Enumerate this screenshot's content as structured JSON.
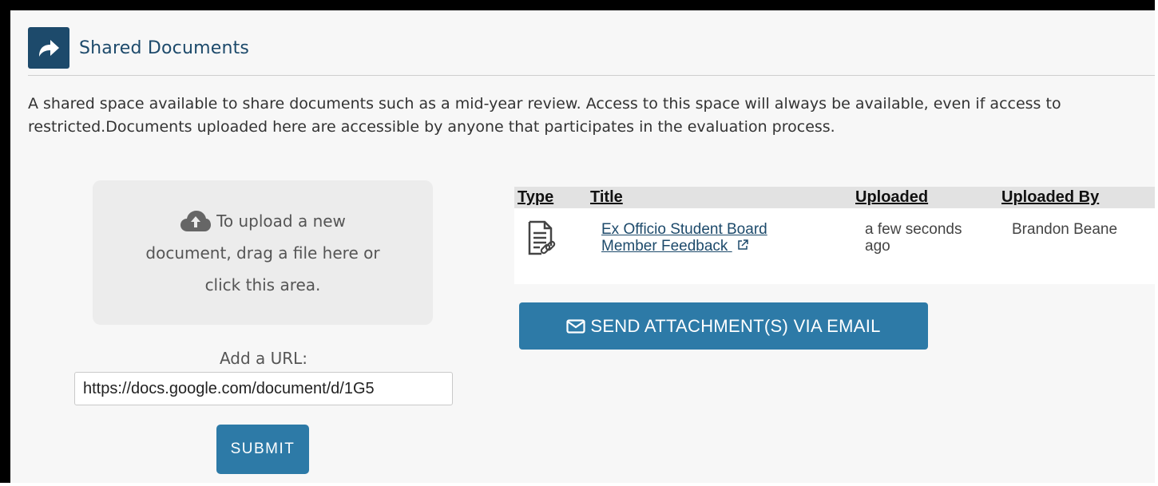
{
  "panel": {
    "title": "Shared Documents",
    "description_line1": "A shared space available to share documents such as a mid-year review. Access to this space will always be available, even if access to",
    "description_line2": "restricted.Documents uploaded here are accessible by anyone that participates in the evaluation process."
  },
  "upload": {
    "dropzone_line1": "To upload a new",
    "dropzone_line2": "document, drag a file here or",
    "dropzone_line3": "click this area.",
    "url_label": "Add a URL:",
    "url_value": "https://docs.google.com/document/d/1G5",
    "submit_label": "SUBMIT"
  },
  "table": {
    "columns": [
      "Type",
      "Title",
      "Uploaded",
      "Uploaded By"
    ],
    "rows": [
      {
        "type_icon": "document-link-icon",
        "title_line1": "Ex Officio Student Board",
        "title_line2": "Member Feedback",
        "uploaded_line1": "a few seconds",
        "uploaded_line2": "ago",
        "uploaded_by": "Brandon Beane"
      }
    ]
  },
  "actions": {
    "email_label": "SEND ATTACHMENT(S) VIA EMAIL"
  },
  "colors": {
    "brand": "#1d4a6b",
    "button": "#2d7aa7",
    "panel_bg": "#f7f7f7"
  }
}
